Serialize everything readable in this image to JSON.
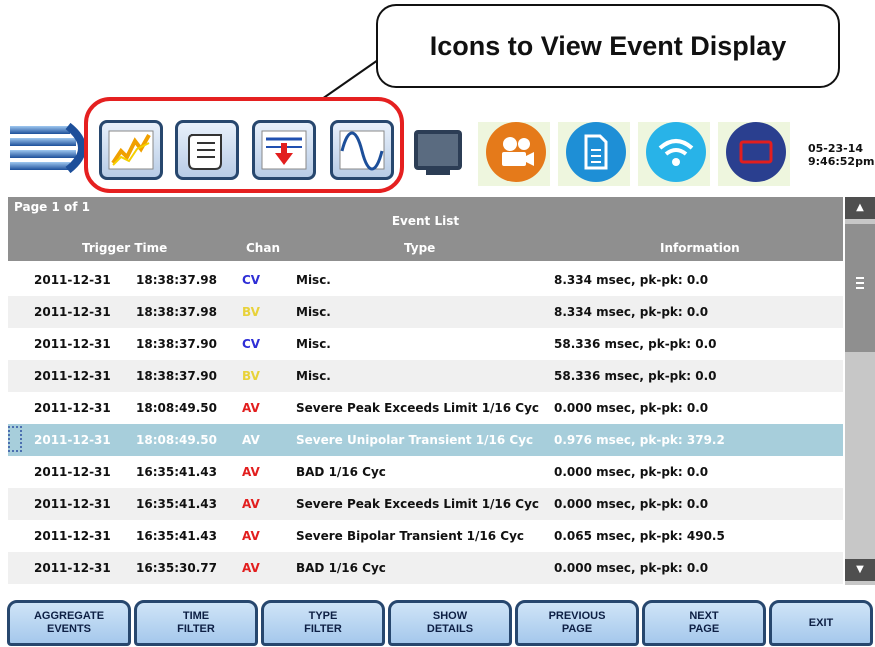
{
  "callout": {
    "text": "Icons to View Event Display"
  },
  "toolbar": {
    "icons": [
      "waveform-chart-icon",
      "scroll-log-icon",
      "threshold-arrow-icon",
      "sine-wave-icon",
      "monitor-icon",
      "video-camera-icon",
      "document-icon",
      "wifi-icon",
      "screen-icon"
    ],
    "date": "05-23-14",
    "time": "9:46:52pm"
  },
  "event_list": {
    "page_info": "Page 1 of 1",
    "title": "Event List",
    "columns": {
      "trigger_time": "Trigger Time",
      "chan": "Chan",
      "type": "Type",
      "information": "Information"
    },
    "rows": [
      {
        "date": "2011-12-31",
        "time": "18:38:37.98",
        "chan": "CV",
        "type": "Misc.",
        "info": "8.334 msec, pk-pk: 0.0"
      },
      {
        "date": "2011-12-31",
        "time": "18:38:37.98",
        "chan": "BV",
        "type": "Misc.",
        "info": "8.334 msec, pk-pk: 0.0"
      },
      {
        "date": "2011-12-31",
        "time": "18:38:37.90",
        "chan": "CV",
        "type": "Misc.",
        "info": "58.336 msec, pk-pk: 0.0"
      },
      {
        "date": "2011-12-31",
        "time": "18:38:37.90",
        "chan": "BV",
        "type": "Misc.",
        "info": "58.336 msec, pk-pk: 0.0"
      },
      {
        "date": "2011-12-31",
        "time": "18:08:49.50",
        "chan": "AV",
        "type": "Severe Peak Exceeds Limit 1/16 Cyc",
        "info": "0.000 msec, pk-pk: 0.0"
      },
      {
        "date": "2011-12-31",
        "time": "18:08:49.50",
        "chan": "AV",
        "type": "Severe Unipolar Transient 1/16 Cyc",
        "info": "0.976 msec, pk-pk: 379.2"
      },
      {
        "date": "2011-12-31",
        "time": "16:35:41.43",
        "chan": "AV",
        "type": "BAD 1/16 Cyc",
        "info": "0.000 msec, pk-pk: 0.0"
      },
      {
        "date": "2011-12-31",
        "time": "16:35:41.43",
        "chan": "AV",
        "type": "Severe Peak Exceeds Limit 1/16 Cyc",
        "info": "0.000 msec, pk-pk: 0.0"
      },
      {
        "date": "2011-12-31",
        "time": "16:35:41.43",
        "chan": "AV",
        "type": "Severe Bipolar Transient 1/16 Cyc",
        "info": "0.065 msec, pk-pk: 490.5"
      },
      {
        "date": "2011-12-31",
        "time": "16:35:30.77",
        "chan": "AV",
        "type": "BAD 1/16 Cyc",
        "info": "0.000 msec, pk-pk: 0.0"
      }
    ],
    "selected_row": 5
  },
  "buttons": {
    "aggregate": "AGGREGATE\nEVENTS",
    "time_filter": "TIME\nFILTER",
    "type_filter": "TYPE\nFILTER",
    "show_details": "SHOW\nDETAILS",
    "previous_page": "PREVIOUS\nPAGE",
    "next_page": "NEXT\nPAGE",
    "exit": "EXIT"
  },
  "colors": {
    "cv": "#2e2ed6",
    "bv": "#e8d23a",
    "av": "#e21e1e",
    "selected": "#a7cedb",
    "header": "#8f8f8f"
  }
}
